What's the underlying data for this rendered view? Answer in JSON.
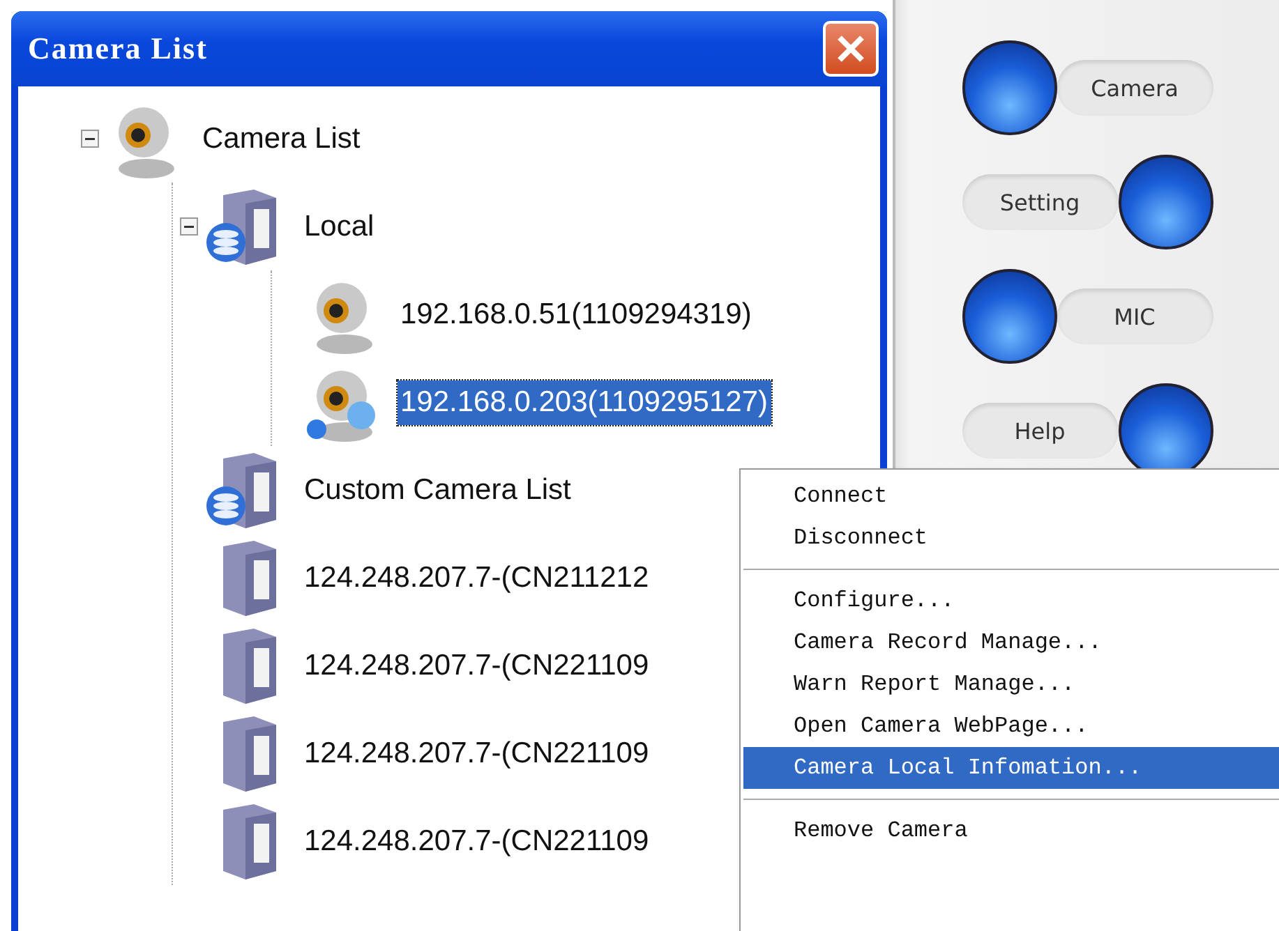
{
  "window": {
    "title": "Camera List"
  },
  "tree": [
    {
      "label": "Camera List",
      "kind": "camera",
      "expanded": true,
      "selected": false,
      "children": [
        {
          "label": "Local",
          "kind": "group",
          "expanded": true,
          "selected": false,
          "children": [
            {
              "label": "192.168.0.51(1109294319)",
              "kind": "camera",
              "selected": false
            },
            {
              "label": "192.168.0.203(1109295127)",
              "kind": "camera-linked",
              "selected": true
            }
          ]
        },
        {
          "label": "Custom Camera List",
          "kind": "group",
          "selected": false
        },
        {
          "label": "124.248.207.7-(CN211212",
          "kind": "server",
          "selected": false
        },
        {
          "label": "124.248.207.7-(CN221109",
          "kind": "server",
          "selected": false
        },
        {
          "label": "124.248.207.7-(CN221109",
          "kind": "server",
          "selected": false
        },
        {
          "label": "124.248.207.7-(CN221109",
          "kind": "server",
          "selected": false
        }
      ]
    }
  ],
  "side_buttons": [
    "Camera",
    "Setting",
    "MIC",
    "Help"
  ],
  "context_menu": [
    {
      "kind": "item",
      "label": "Connect",
      "selected": false
    },
    {
      "kind": "item",
      "label": "Disconnect",
      "selected": false
    },
    {
      "kind": "separator"
    },
    {
      "kind": "item",
      "label": "Configure...",
      "selected": false
    },
    {
      "kind": "item",
      "label": "Camera Record Manage...",
      "selected": false
    },
    {
      "kind": "item",
      "label": "Warn Report Manage...",
      "selected": false
    },
    {
      "kind": "item",
      "label": "Open Camera WebPage...",
      "selected": false
    },
    {
      "kind": "item",
      "label": "Camera Local Infomation...",
      "selected": true
    },
    {
      "kind": "separator"
    },
    {
      "kind": "item",
      "label": "Remove Camera",
      "selected": false
    }
  ]
}
